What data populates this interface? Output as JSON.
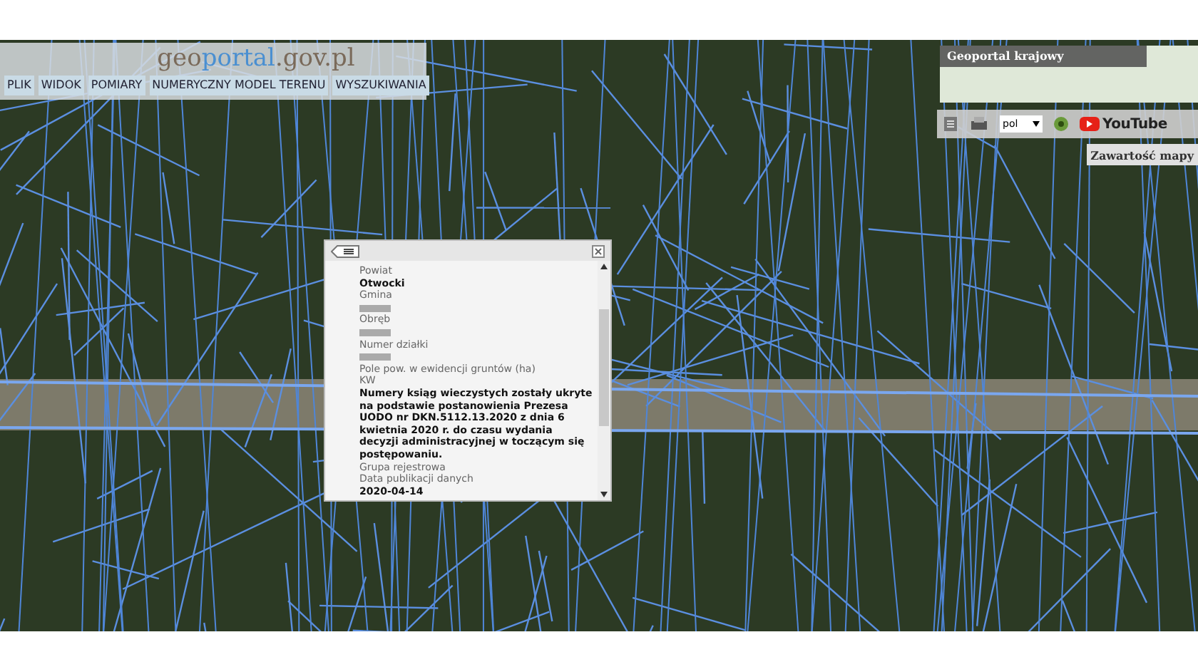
{
  "header": {
    "logo": [
      {
        "text": "geo",
        "kind": "plain"
      },
      {
        "text": "portal",
        "kind": "accent"
      },
      {
        "text": ".gov.pl",
        "kind": "plain"
      }
    ],
    "menu": [
      "PLIK",
      "WIDOK",
      "POMIARY",
      "NUMERYCZNY MODEL TERENU",
      "WYSZUKIWANIA"
    ]
  },
  "overview": {
    "title": "Geoportal krajowy"
  },
  "toolbar": {
    "language": "pol",
    "video_label": "YouTube"
  },
  "map_contents_button": "Zawartość mapy",
  "popup": {
    "fields": [
      {
        "kind": "label",
        "text": "Powiat"
      },
      {
        "kind": "value",
        "text": "Otwocki"
      },
      {
        "kind": "label",
        "text": "Gmina"
      },
      {
        "kind": "redacted"
      },
      {
        "kind": "label",
        "text": "Obręb"
      },
      {
        "kind": "redacted"
      },
      {
        "kind": "label",
        "text": "Numer działki"
      },
      {
        "kind": "redacted"
      },
      {
        "kind": "label",
        "text": "Pole pow. w ewidencji gruntów (ha)"
      },
      {
        "kind": "label",
        "text": "KW"
      },
      {
        "kind": "value",
        "text": "Numery ksiąg wieczystych zostały ukryte na podstawie postanowienia Prezesa UODO nr DKN.5112.13.2020 z dnia 6 kwietnia 2020 r. do czasu wydania decyzji administracyjnej w toczącym się postępowaniu."
      },
      {
        "kind": "label",
        "text": "Grupa rejestrowa"
      },
      {
        "kind": "label",
        "text": "Data publikacji danych"
      },
      {
        "kind": "value",
        "text": "2020-04-14"
      }
    ]
  }
}
